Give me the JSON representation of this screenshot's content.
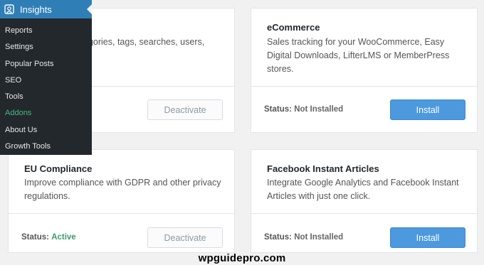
{
  "sidebar": {
    "title": "Insights",
    "items": [
      {
        "label": "Reports"
      },
      {
        "label": "Settings"
      },
      {
        "label": "Popular Posts"
      },
      {
        "label": "SEO"
      },
      {
        "label": "Tools"
      },
      {
        "label": "Addons",
        "active": true
      },
      {
        "label": "About Us"
      },
      {
        "label": "Growth Tools"
      }
    ]
  },
  "addons": [
    {
      "title": "",
      "description": "egories, tags, searches, users,",
      "status_label": "",
      "status_value": "",
      "button_label": "Deactivate"
    },
    {
      "title": "eCommerce",
      "description": "Sales tracking for your WooCommerce, Easy Digital Downloads, LifterLMS or MemberPress stores.",
      "status_label": "Status:",
      "status_value": "Not Installed",
      "button_label": "Install"
    },
    {
      "title": "EU Compliance",
      "description": "Improve compliance with GDPR and other privacy regulations.",
      "status_label": "Status:",
      "status_value": "Active",
      "button_label": "Deactivate"
    },
    {
      "title": "Facebook Instant Articles",
      "description": "Integrate Google Analytics and Facebook Instant Articles with just one click.",
      "status_label": "Status:",
      "status_value": "Not Installed",
      "button_label": "Install"
    }
  ],
  "watermark": "wpguidepro.com",
  "colors": {
    "sidebar_bg": "#23282d",
    "sidebar_header": "#2f7fb6",
    "active_item": "#46b97d",
    "install_button": "#4d99de",
    "status_active": "#3c9b6e"
  }
}
